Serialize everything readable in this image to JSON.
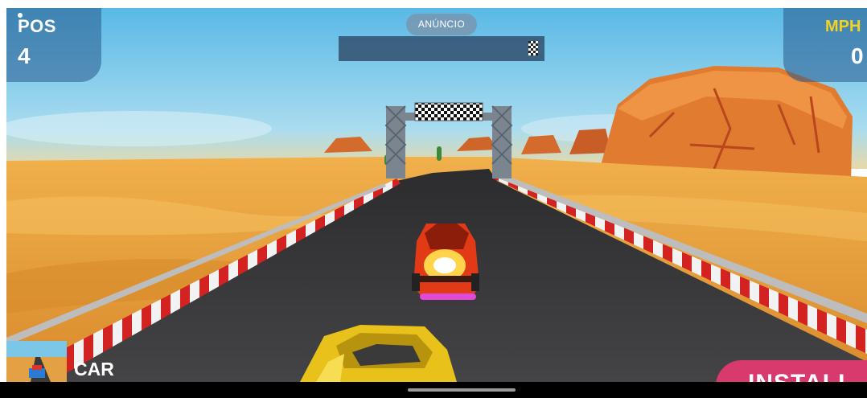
{
  "hud": {
    "position_label": "POS",
    "position_value": "4",
    "speed_label": "MPH",
    "speed_value": "0"
  },
  "ad": {
    "label": "ANÚNCIO",
    "game_title": "CAR",
    "install_label": "INSTALL"
  },
  "colors": {
    "sky": "#6fc6ea",
    "sand": "#e9a23f",
    "road": "#3a3a3c",
    "rival_car": "#e23a16",
    "player_car": "#e8c21a",
    "install": "#d83a6e",
    "speed_label": "#f5d21b"
  },
  "icons": {
    "ad_close": "checkered-close-icon",
    "home": "home-indicator"
  }
}
